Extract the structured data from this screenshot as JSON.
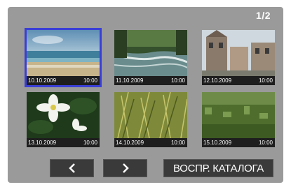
{
  "page_indicator": "1/2",
  "thumbnails": [
    {
      "date": "10.10.2009",
      "time": "10:00",
      "scene": "beach",
      "selected": true
    },
    {
      "date": "11.10.2009",
      "time": "10:00",
      "scene": "river",
      "selected": false
    },
    {
      "date": "12.10.2009",
      "time": "10:00",
      "scene": "town",
      "selected": false
    },
    {
      "date": "13.10.2009",
      "time": "10:00",
      "scene": "flower",
      "selected": false
    },
    {
      "date": "14.10.2009",
      "time": "10:00",
      "scene": "grass",
      "selected": false
    },
    {
      "date": "15.10.2009",
      "time": "10:00",
      "scene": "field",
      "selected": false
    }
  ],
  "buttons": {
    "prev_icon": "chevron-left-icon",
    "next_icon": "chevron-right-icon",
    "catalog_label": "ВОСПР. КАТАЛОГА"
  },
  "colors": {
    "screen_bg": "#9a9a9a",
    "selection": "#3a3fd6",
    "button_bg": "#3a3a3a"
  }
}
